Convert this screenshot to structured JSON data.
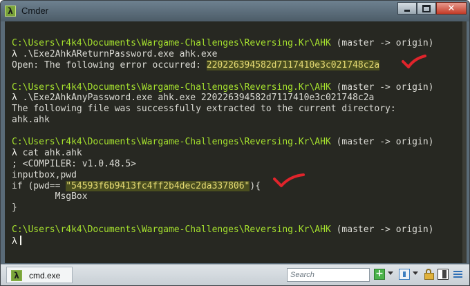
{
  "window": {
    "title": "Cmder",
    "app_icon": "λ"
  },
  "console": {
    "lines": [
      {
        "type": "path",
        "path": "C:\\Users\\r4k4\\Documents\\Wargame-Challenges\\Reversing.Kr\\AHK",
        "branch": " (master -> origin)"
      },
      {
        "type": "cmd",
        "prompt": "λ",
        "text": " .\\Exe2AhkAReturnPassword.exe ahk.exe"
      },
      {
        "type": "out_hl",
        "pre": "Open: The following error occurred: ",
        "hl": "220226394582d7117410e3c021748c2a"
      },
      {
        "type": "blank"
      },
      {
        "type": "path",
        "path": "C:\\Users\\r4k4\\Documents\\Wargame-Challenges\\Reversing.Kr\\AHK",
        "branch": " (master -> origin)"
      },
      {
        "type": "cmd",
        "prompt": "λ",
        "text": " .\\Exe2AhkAnyPassword.exe ahk.exe 220226394582d7117410e3c021748c2a"
      },
      {
        "type": "out",
        "text": "The following file was successfully extracted to the current directory:"
      },
      {
        "type": "out",
        "text": "ahk.ahk"
      },
      {
        "type": "blank"
      },
      {
        "type": "path",
        "path": "C:\\Users\\r4k4\\Documents\\Wargame-Challenges\\Reversing.Kr\\AHK",
        "branch": " (master -> origin)"
      },
      {
        "type": "cmd",
        "prompt": "λ",
        "text": " cat ahk.ahk"
      },
      {
        "type": "out",
        "text": "; <COMPILER: v1.0.48.5>"
      },
      {
        "type": "out",
        "text": "inputbox,pwd"
      },
      {
        "type": "out_str",
        "pre": "if (pwd== ",
        "str": "\"54593f6b9413fc4ff2b4dec2da337806\"",
        "post": "){"
      },
      {
        "type": "out",
        "text": "        MsgBox"
      },
      {
        "type": "out",
        "text": "}"
      },
      {
        "type": "blank"
      },
      {
        "type": "path",
        "path": "C:\\Users\\r4k4\\Documents\\Wargame-Challenges\\Reversing.Kr\\AHK",
        "branch": " (master -> origin)"
      },
      {
        "type": "prompt",
        "prompt": "λ"
      }
    ]
  },
  "tabbar": {
    "tab_label": "cmd.exe",
    "tab_icon": "λ",
    "search_placeholder": "Search",
    "icons": [
      "new-console-icon",
      "dropdown-icon",
      "console-list-icon",
      "dropdown-icon",
      "lock-icon",
      "split-icon",
      "menu-icon"
    ]
  },
  "colors": {
    "path": "#a6e22e",
    "string": "#e6db74",
    "annotation": "#e0242b",
    "console_bg": "#272822"
  }
}
